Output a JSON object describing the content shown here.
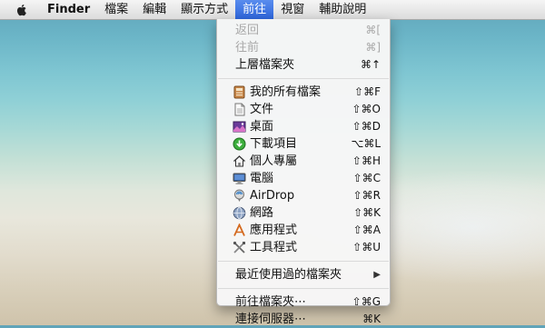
{
  "menubar": {
    "app_name": "Finder",
    "items": [
      "檔案",
      "編輯",
      "顯示方式",
      "前往",
      "視窗",
      "輔助說明"
    ]
  },
  "go_menu": {
    "back": {
      "label": "返回",
      "shortcut": "⌘["
    },
    "forward": {
      "label": "往前",
      "shortcut": "⌘]"
    },
    "enclosing": {
      "label": "上層檔案夾",
      "shortcut": "⌘↑"
    },
    "places": [
      {
        "label": "我的所有檔案",
        "shortcut": "⇧⌘F",
        "icon": "all-my-files-icon"
      },
      {
        "label": "文件",
        "shortcut": "⇧⌘O",
        "icon": "documents-icon"
      },
      {
        "label": "桌面",
        "shortcut": "⇧⌘D",
        "icon": "desktop-icon"
      },
      {
        "label": "下載項目",
        "shortcut": "⌥⌘L",
        "icon": "downloads-icon"
      },
      {
        "label": "個人專屬",
        "shortcut": "⇧⌘H",
        "icon": "home-icon"
      },
      {
        "label": "電腦",
        "shortcut": "⇧⌘C",
        "icon": "computer-icon"
      },
      {
        "label": "AirDrop",
        "shortcut": "⇧⌘R",
        "icon": "airdrop-icon"
      },
      {
        "label": "網路",
        "shortcut": "⇧⌘K",
        "icon": "network-icon"
      },
      {
        "label": "應用程式",
        "shortcut": "⇧⌘A",
        "icon": "applications-icon"
      },
      {
        "label": "工具程式",
        "shortcut": "⇧⌘U",
        "icon": "utilities-icon"
      }
    ],
    "recent": {
      "label": "最近使用過的檔案夾",
      "submenu_arrow": "▶"
    },
    "go_to_folder": {
      "label": "前往檔案夾⋯",
      "shortcut": "⇧⌘G"
    },
    "connect_server": {
      "label": "連接伺服器⋯",
      "shortcut": "⌘K"
    }
  }
}
